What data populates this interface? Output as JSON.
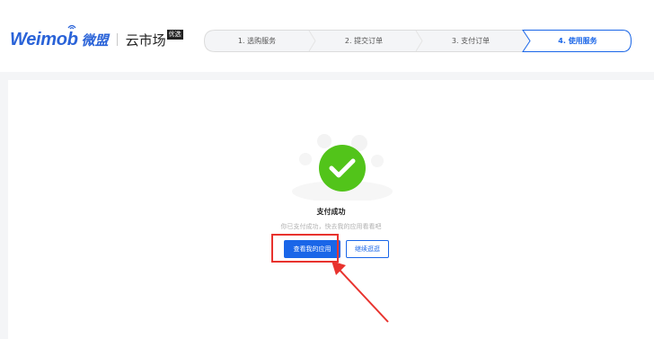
{
  "header": {
    "logo_en": "Weimob",
    "logo_cn": "微盟",
    "market": "云市场",
    "badge": "优选"
  },
  "steps": [
    {
      "label": "1. 选购服务",
      "active": false
    },
    {
      "label": "2. 提交订单",
      "active": false
    },
    {
      "label": "3. 支付订单",
      "active": false
    },
    {
      "label": "4. 使用服务",
      "active": true
    }
  ],
  "result": {
    "title": "支付成功",
    "subtitle": "你已支付成功，快去我的应用看看吧",
    "primary_button": "查看我的应用",
    "secondary_button": "继续逛逛"
  },
  "colors": {
    "brand": "#2a63d8",
    "accent": "#1a66e8",
    "success": "#52c41a",
    "annotation": "#e8332e"
  }
}
